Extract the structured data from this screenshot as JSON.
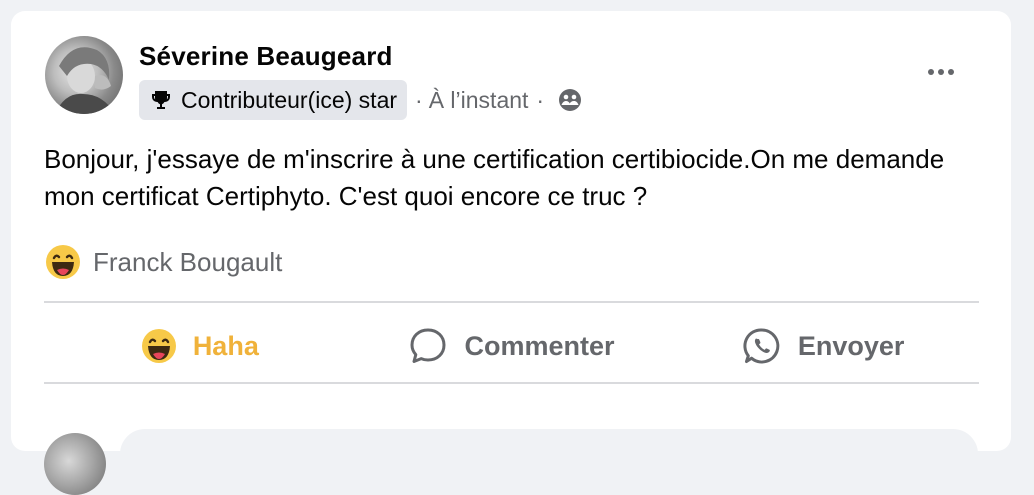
{
  "post": {
    "author": "Séverine Beaugeard",
    "badge": "Contributeur(ice) star",
    "separator_1": "·",
    "time": "À l’instant",
    "separator_2": "·",
    "text": "Bonjour, j'essaye de m'inscrire à une certification certibiocide.On me demande mon certificat Certiphyto. C'est quoi encore ce truc ?",
    "reactions": {
      "icon": "haha-emoji",
      "names": "Franck Bougault"
    }
  },
  "actions": {
    "react_label": "Haha",
    "comment_label": "Commenter",
    "send_label": "Envoyer"
  },
  "icons": {
    "badge": "trophy-icon",
    "audience": "friends-icon",
    "more": "more-options-icon",
    "comment": "comment-bubble-icon",
    "send": "whatsapp-icon"
  },
  "colors": {
    "haha_accent": "#f0b23a",
    "secondary_text": "#65676b",
    "badge_bg": "#e4e6eb"
  }
}
